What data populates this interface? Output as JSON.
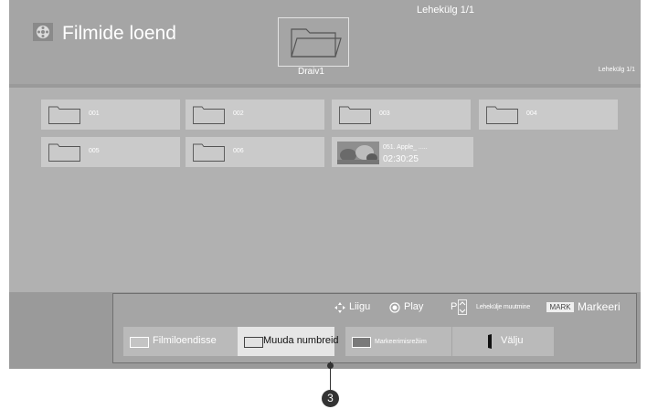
{
  "header": {
    "title": "Filmide loend",
    "page_top": "Lehekülg 1/1",
    "drive_label": "Draiv1",
    "page_right": "Lehekülg 1/1",
    "app_icon": "film-reel-icon"
  },
  "folders": [
    {
      "label": "001",
      "icon": "folder-icon"
    },
    {
      "label": "002",
      "icon": "folder-icon"
    },
    {
      "label": "003",
      "icon": "folder-icon"
    },
    {
      "label": "004",
      "icon": "folder-icon"
    },
    {
      "label": "005",
      "icon": "folder-icon"
    },
    {
      "label": "006",
      "icon": "folder-icon"
    }
  ],
  "video": {
    "name": "051. Apple_ .....",
    "duration": "02:30:25",
    "icon": "video-thumbnail"
  },
  "hints": {
    "move": "Liigu",
    "play": "Play",
    "p_label": "P",
    "page_change": "Lehekülje muutmine",
    "mark_badge": "MARK",
    "mark": "Markeeri"
  },
  "buttons": {
    "movie_list": "Filmiloendisse",
    "change_numbers": "Muuda numbreid",
    "mark_mode": "Markeerimisrežiim",
    "exit": "Välju"
  },
  "colors": {
    "red_swatch": "#c4c4c4",
    "green_swatch": "#e2e2e2",
    "yellow_swatch": "#7a7a7a"
  },
  "callout": "3"
}
